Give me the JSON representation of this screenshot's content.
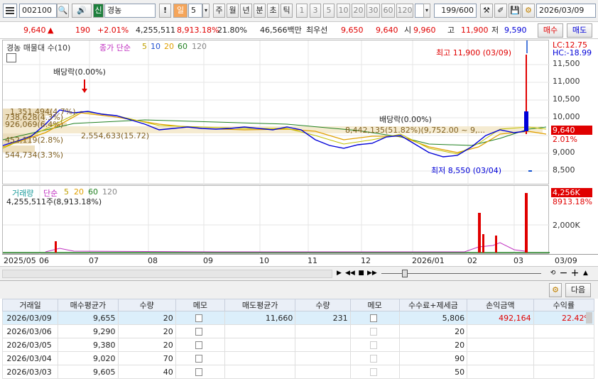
{
  "toolbar": {
    "code": "002100",
    "market_tag": "신",
    "name": "경농",
    "period_tag": "일",
    "period_num": "5",
    "periods": [
      "주",
      "월",
      "년",
      "분",
      "초",
      "틱"
    ],
    "nums": [
      "1",
      "3",
      "5",
      "10",
      "20",
      "30",
      "60",
      "120"
    ],
    "count": "199",
    "total": "/600",
    "date": "2026/03/09"
  },
  "quote": {
    "price": "9,640",
    "change_arrow": "▲",
    "change": "190",
    "pct": "+2.01%",
    "volume": "4,255,511",
    "vol_pct": "8,913.18%",
    "turnover": "21.80%",
    "amount": "46,566백만",
    "best_label": "최우선",
    "best_ask": "9,650",
    "best_bid": "9,640",
    "open_label": "시",
    "open": "9,960",
    "high_label": "고",
    "high": "11,900",
    "low_label": "저",
    "low": "9,590",
    "buy_btn": "매수",
    "sell_btn": "매도"
  },
  "price_panel": {
    "legend_name": "경농 매물대 수(10)",
    "ma_label": "종가 단순",
    "ma": [
      "5",
      "10",
      "20",
      "60",
      "120"
    ],
    "lc": "LC:12.75",
    "hc": "HC:-18.99",
    "scale": [
      "11,500",
      "11,000",
      "10,500",
      "10,000",
      "9,000",
      "8,500"
    ],
    "cur_price_tag": "9,640",
    "cur_pct_tag": "2.01%",
    "high_note": "최고 11,900 (03/09)",
    "low_note": "최저 8,550 (03/04)",
    "div1": "배당락(0.00%)",
    "div2": "배당락(0.00%)",
    "vp_labels": [
      "1,351,494(4.7%)",
      "738,628(4.3%)",
      "926,069(6.4%)",
      "452,119(2.8%)",
      "544,734(3.3%)",
      "2,554,633(15.72)"
    ],
    "vp_main": "8,442,135(51.82%)(9,752.00 ~ 9,..."
  },
  "volume_panel": {
    "title": "거래량",
    "ma_label": "단순",
    "ma": [
      "5",
      "20",
      "60",
      "120"
    ],
    "info": "4,255,511주(8,913.18%)",
    "tag1": "4,256K",
    "tag2": "8913.18%",
    "scale": "2,000K"
  },
  "axis": {
    "labels": [
      "2025/05",
      "06",
      "07",
      "08",
      "09",
      "10",
      "11",
      "12",
      "2026/01",
      "02",
      "03"
    ],
    "end": "03/09"
  },
  "grid": {
    "next_btn": "다음",
    "columns": [
      "거래일",
      "매수평균가",
      "수량",
      "메모",
      "매도평균가",
      "수량",
      "메모",
      "수수료+제세금",
      "손익금액",
      "수익률"
    ],
    "rows": [
      {
        "date": "2026/03/09",
        "buy_avg": "9,655",
        "buy_qty": "20",
        "sell_avg": "11,660",
        "sell_qty": "231",
        "fee": "5,806",
        "pnl": "492,164",
        "ret": "22.42%"
      },
      {
        "date": "2026/03/06",
        "buy_avg": "9,290",
        "buy_qty": "20",
        "sell_avg": "",
        "sell_qty": "",
        "fee": "20",
        "pnl": "",
        "ret": ""
      },
      {
        "date": "2026/03/05",
        "buy_avg": "9,380",
        "buy_qty": "20",
        "sell_avg": "",
        "sell_qty": "",
        "fee": "20",
        "pnl": "",
        "ret": ""
      },
      {
        "date": "2026/03/04",
        "buy_avg": "9,020",
        "buy_qty": "70",
        "sell_avg": "",
        "sell_qty": "",
        "fee": "90",
        "pnl": "",
        "ret": ""
      },
      {
        "date": "2026/03/03",
        "buy_avg": "9,605",
        "buy_qty": "40",
        "sell_avg": "",
        "sell_qty": "",
        "fee": "50",
        "pnl": "",
        "ret": ""
      }
    ]
  },
  "colors": {
    "up": "#e00000",
    "down": "#0000d8",
    "ma5": "#c0c000",
    "ma20": "#e0a000",
    "ma60": "#208020"
  }
}
